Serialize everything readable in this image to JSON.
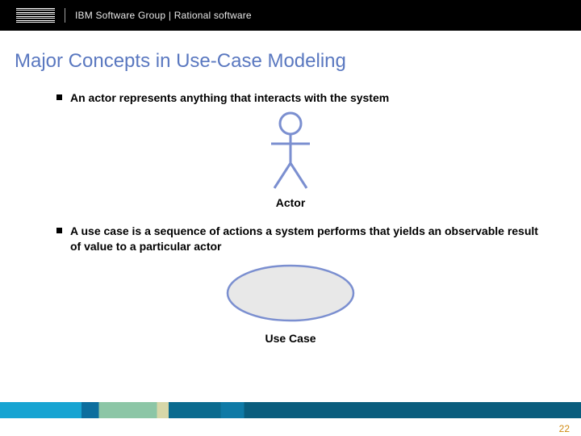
{
  "header": {
    "logo_alt": "IBM",
    "text": "IBM Software Group | Rational software"
  },
  "title": "Major Concepts in Use-Case Modeling",
  "bullets": [
    {
      "text": "An actor represents anything that interacts with the system",
      "figure": "actor",
      "figure_label": "Actor"
    },
    {
      "text": "A use case is a sequence of actions a system performs that yields an observable result of value to a particular actor",
      "figure": "usecase",
      "figure_label": "Use Case"
    }
  ],
  "page_number": "22",
  "colors": {
    "title": "#5a78c0",
    "actor_stroke": "#7b8fd0",
    "oval_stroke": "#7b8fd0",
    "oval_fill": "#e8e8e8"
  }
}
